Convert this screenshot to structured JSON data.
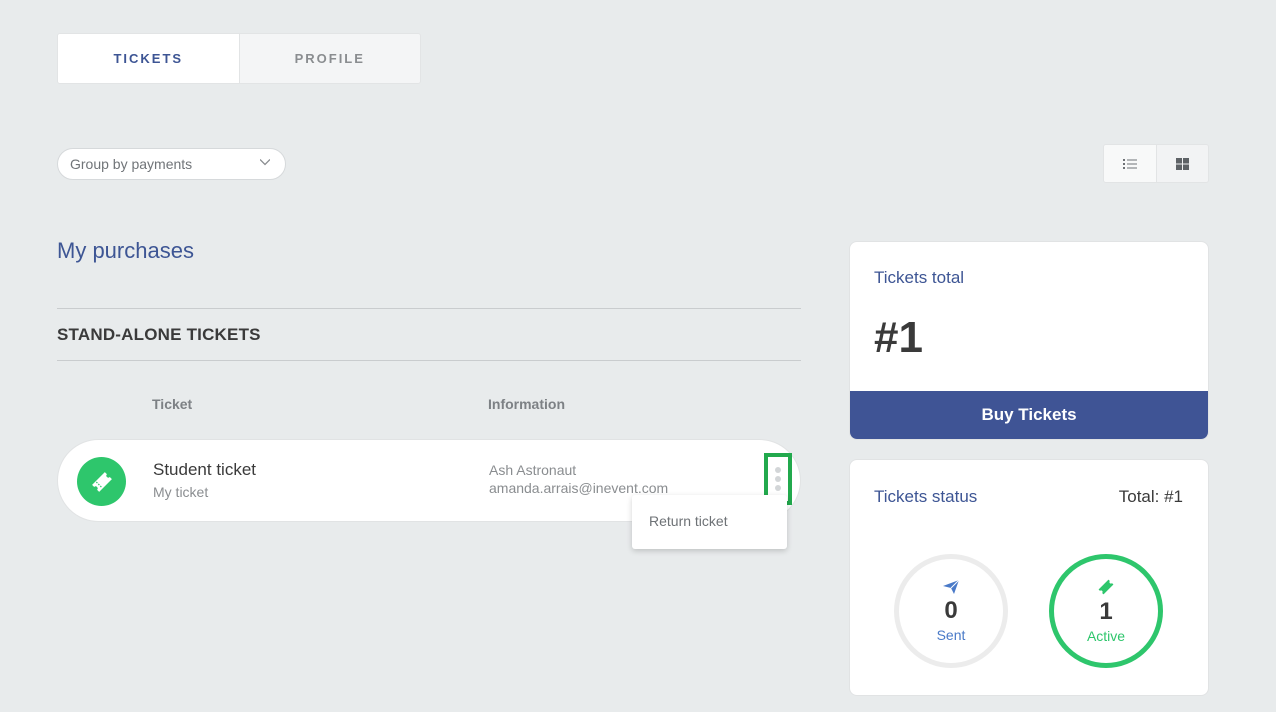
{
  "tabs": [
    {
      "label": "TICKETS",
      "active": true
    },
    {
      "label": "PROFILE",
      "active": false
    }
  ],
  "group_select": {
    "value": "Group by payments"
  },
  "view_toggle": {
    "list_icon": "list-icon",
    "grid_icon": "grid-icon"
  },
  "purchases": {
    "title": "My purchases",
    "section_title": "STAND-ALONE TICKETS",
    "columns": {
      "ticket": "Ticket",
      "information": "Information"
    },
    "tickets": [
      {
        "name": "Student ticket",
        "subtitle": "My ticket",
        "holder_name": "Ash Astronaut",
        "holder_email": "amanda.arrais@inevent.com",
        "icon": "ticket-icon"
      }
    ]
  },
  "menu": {
    "items": [
      {
        "label": "Return ticket"
      }
    ]
  },
  "tickets_total": {
    "label": "Tickets total",
    "value": "#1",
    "buy_label": "Buy Tickets"
  },
  "tickets_status": {
    "label": "Tickets status",
    "total": "Total: #1",
    "sent": {
      "value": "0",
      "label": "Sent",
      "icon": "paper-plane-icon"
    },
    "active": {
      "value": "1",
      "label": "Active",
      "icon": "ticket-icon"
    }
  },
  "colors": {
    "accent": "#3d5594",
    "green": "#2ec66c",
    "highlight": "#22a94d",
    "background": "#e8ebec"
  }
}
